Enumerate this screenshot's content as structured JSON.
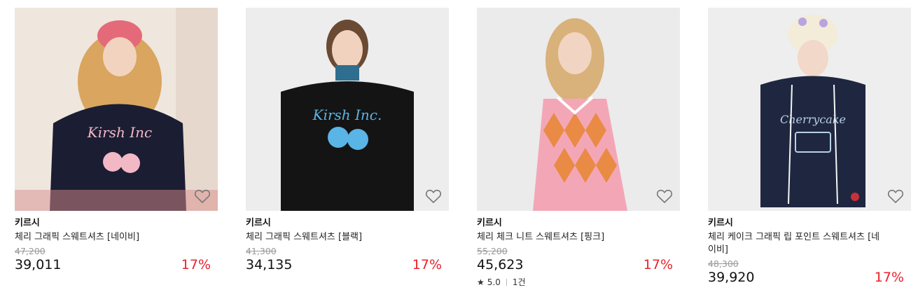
{
  "products": [
    {
      "brand": "키르시",
      "name": "체리 그래픽 스웨트셔츠 [네이비]",
      "original_price": "47,200",
      "price": "39,011",
      "discount": "17%",
      "rating": null,
      "colors": {
        "background": "#efe6de",
        "garment": "#1b1d33",
        "graphic": "#f2b8c6"
      }
    },
    {
      "brand": "키르시",
      "name": "체리 그래픽 스웨트셔츠 [블랙]",
      "original_price": "41,300",
      "price": "34,135",
      "discount": "17%",
      "rating": null,
      "colors": {
        "background": "#ededed",
        "garment": "#141414",
        "graphic": "#5ab4e6"
      }
    },
    {
      "brand": "키르시",
      "name": "체리 체크 니트 스웨트셔츠 [핑크]",
      "original_price": "55,200",
      "price": "45,623",
      "discount": "17%",
      "rating": {
        "star_icon": "star-icon",
        "score": "5.0",
        "count": "1건"
      },
      "colors": {
        "background": "#ebebeb",
        "garment": "#f3a7b6",
        "graphic": "#e98a45"
      }
    },
    {
      "brand": "키르시",
      "name": "체리 케이크 그래픽 립 포인트 스웨트셔츠 [네이비]",
      "original_price": "48,300",
      "price": "39,920",
      "discount": "17%",
      "rating": null,
      "colors": {
        "background": "#eeeeee",
        "garment": "#1f2740",
        "graphic": "#b9cfe6"
      }
    }
  ],
  "icons": {
    "wishlist": "heart-outline-icon"
  }
}
